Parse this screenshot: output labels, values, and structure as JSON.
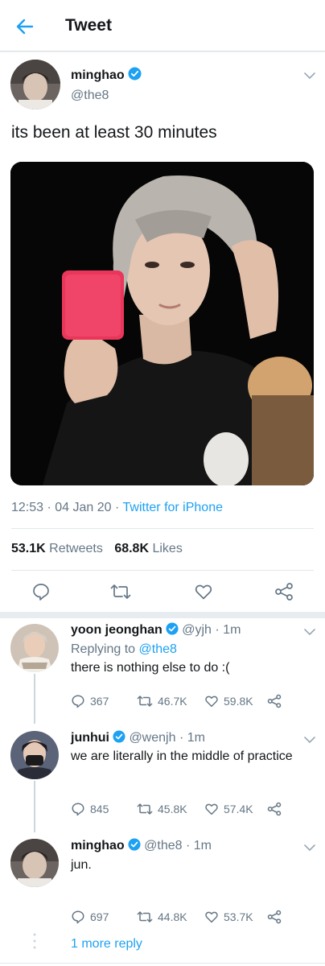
{
  "header": {
    "title": "Tweet"
  },
  "tweet": {
    "display_name": "minghao",
    "handle": "@the8",
    "text": "its been at least 30 minutes",
    "time": "12:53",
    "date": "04 Jan 20",
    "source": "Twitter for iPhone",
    "sep": "·",
    "retweets_count": "53.1K",
    "retweets_label": "Retweets",
    "likes_count": "68.8K",
    "likes_label": "Likes"
  },
  "replies": [
    {
      "display_name": "yoon jeonghan",
      "handle": "@yjh",
      "time": "1m",
      "replying_prefix": "Replying to",
      "replying_to": "@the8",
      "text": "there is nothing else to do :(",
      "replies": "367",
      "retweets": "46.7K",
      "likes": "59.8K"
    },
    {
      "display_name": "junhui",
      "handle": "@wenjh",
      "time": "1m",
      "text": "we are literally in the middle of practice",
      "replies": "845",
      "retweets": "45.8K",
      "likes": "57.4K"
    },
    {
      "display_name": "minghao",
      "handle": "@the8",
      "time": "1m",
      "text": "jun.",
      "replies": "697",
      "retweets": "44.8K",
      "likes": "53.7K"
    }
  ],
  "more_replies": "1 more reply",
  "colors": {
    "accent": "#1da1f2",
    "secondary": "#657786",
    "text": "#14171a",
    "divider": "#e1e8ed"
  },
  "icons": [
    "back-arrow-icon",
    "verified-icon",
    "chevron-down-icon",
    "reply-icon",
    "retweet-icon",
    "like-icon",
    "share-icon"
  ]
}
